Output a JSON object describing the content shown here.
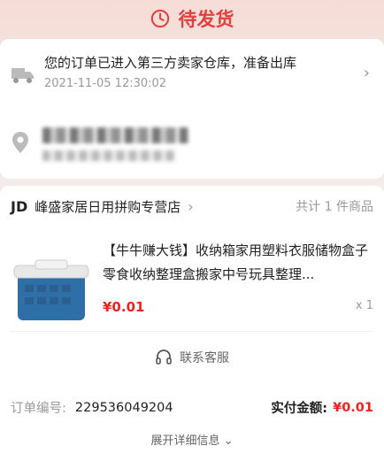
{
  "status": {
    "title": "待发货",
    "color": "#e24040"
  },
  "logistics": {
    "message": "您的订单已进入第三方卖家仓库，准备出库",
    "time": "2021-11-05 12:30:02"
  },
  "shop": {
    "prefix": "JD",
    "name": "峰盛家居日用拼购专营店",
    "total": "共计 1 件商品"
  },
  "product": {
    "title": "【牛牛赚大钱】收纳箱家用塑料衣服储物盒子零食收纳整理盒搬家中号玩具整理...",
    "price": "¥0.01",
    "qty": "x 1"
  },
  "service": {
    "label": "联系客服"
  },
  "order": {
    "label": "订单编号:",
    "number": "229536049204",
    "paid_label": "实付金额:",
    "paid_value": "¥0.01",
    "expand": "展开详细信息"
  }
}
